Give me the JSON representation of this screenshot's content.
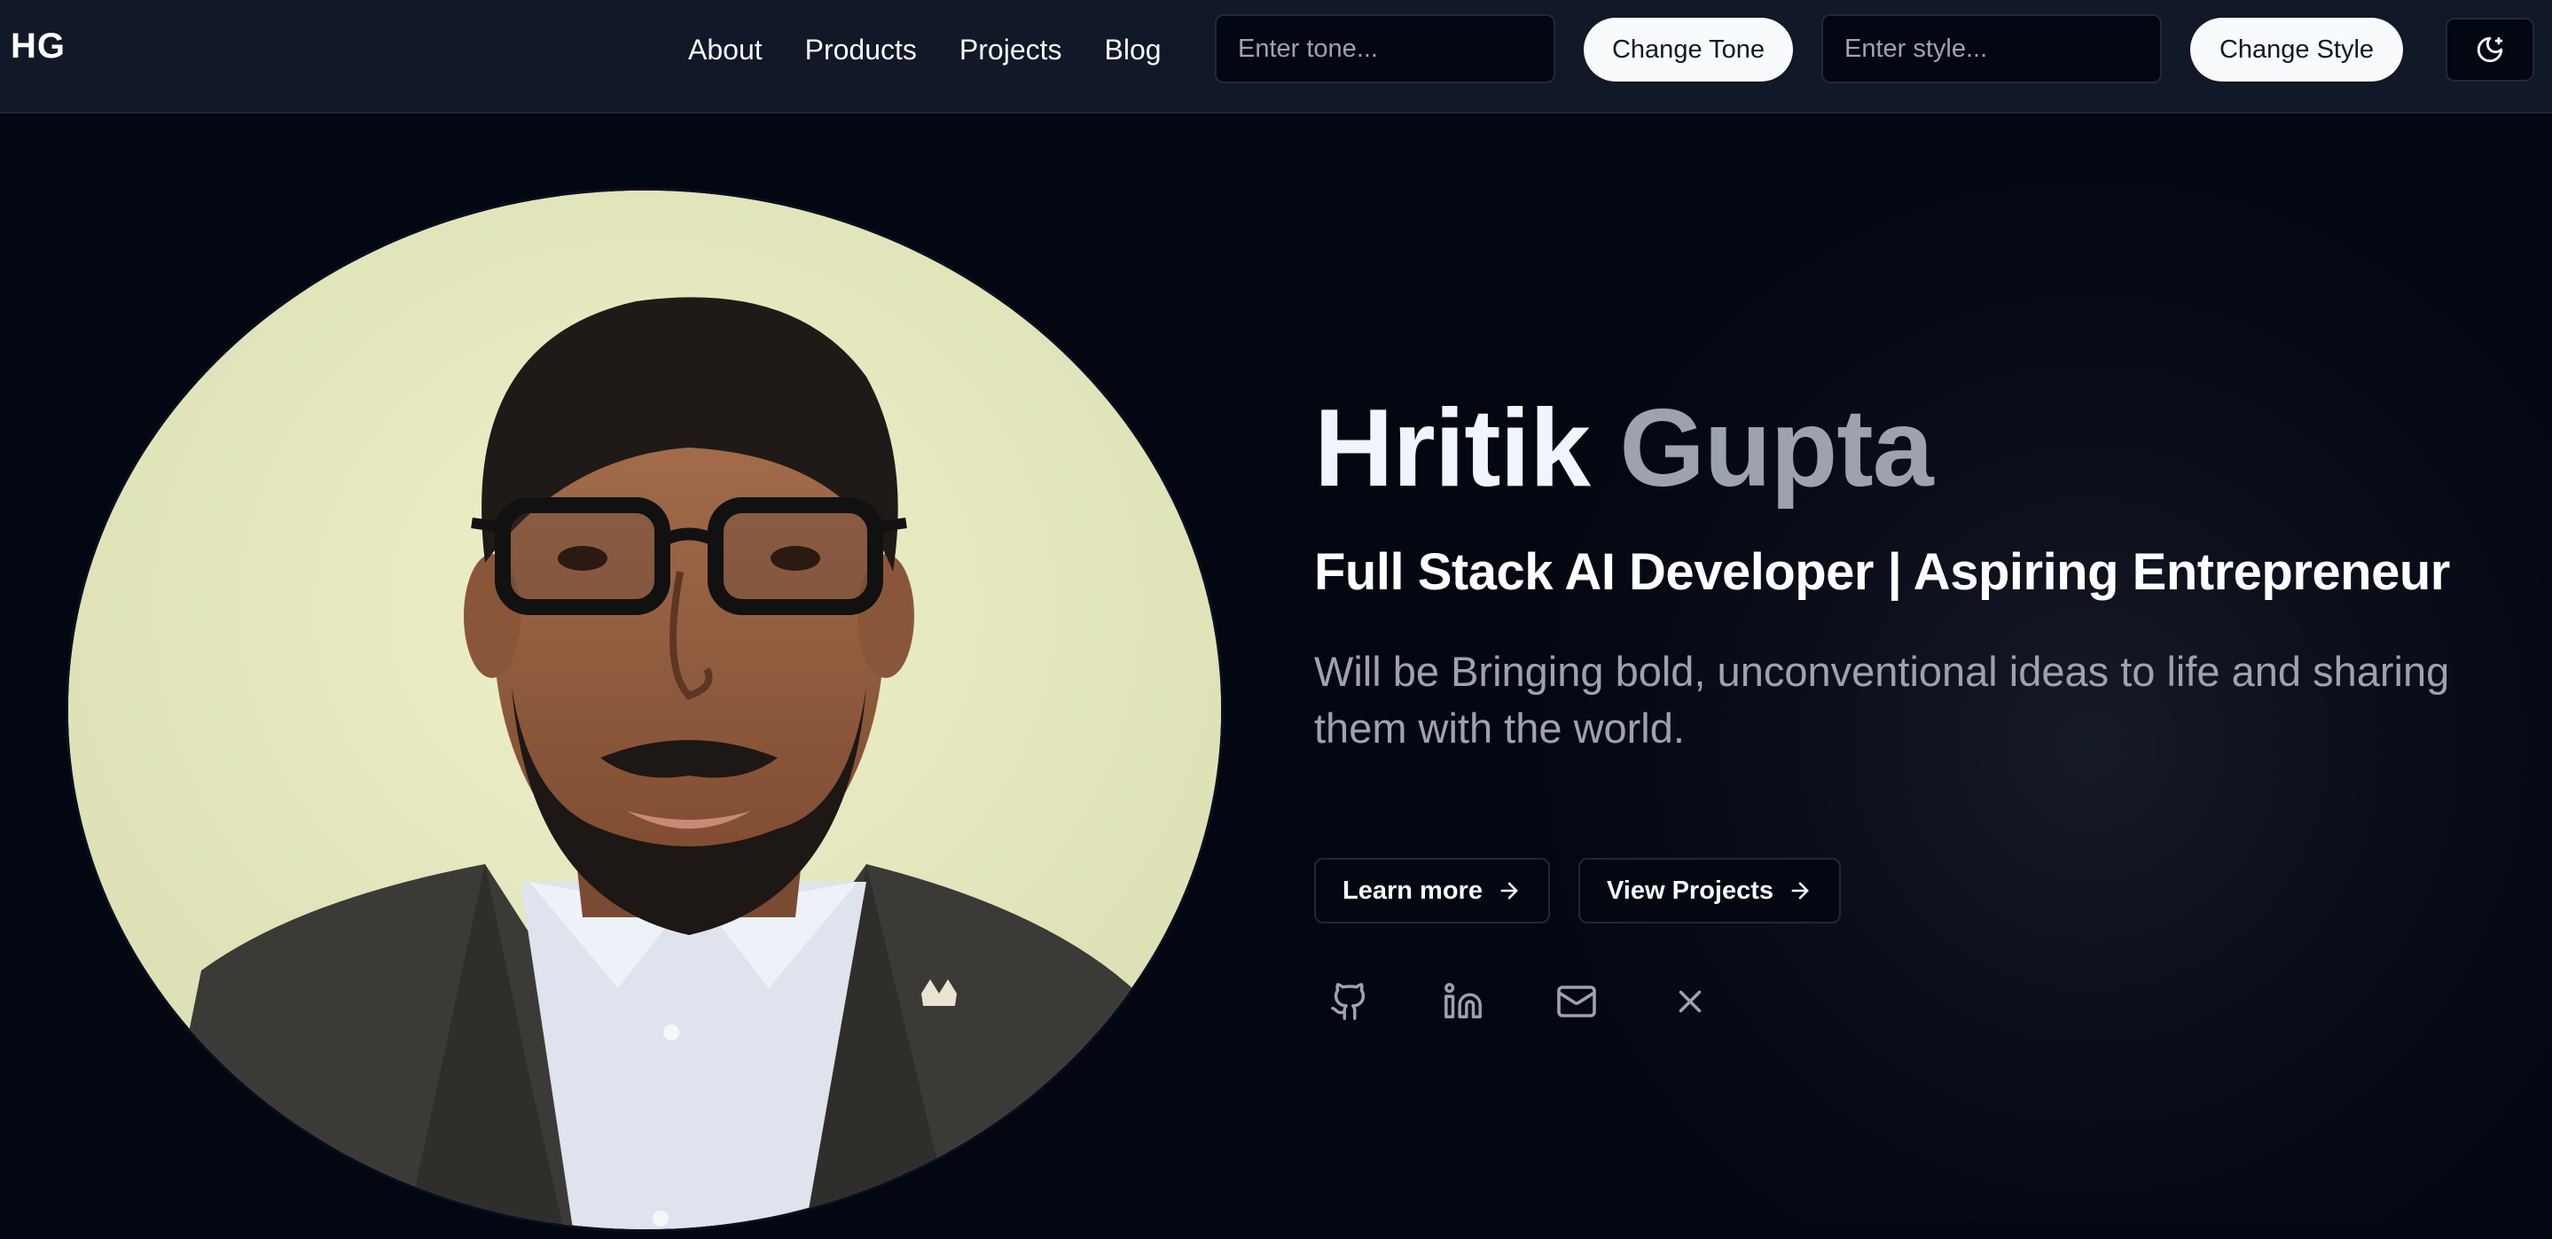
{
  "nav": {
    "logo": "HG",
    "links": [
      "About",
      "Products",
      "Projects",
      "Blog"
    ],
    "tone_placeholder": "Enter tone...",
    "tone_button": "Change Tone",
    "style_placeholder": "Enter style...",
    "style_button": "Change Style",
    "theme_icon": "moon-stars-icon"
  },
  "hero": {
    "name_first": "Hritik",
    "name_last": "Gupta",
    "subtitle": "Full Stack AI Developer | Aspiring Entrepreneur",
    "bio": "Will be Bringing bold, unconventional ideas to life and sharing them with the world.",
    "learn_more": "Learn more",
    "view_projects": "View Projects",
    "socials": [
      "github-icon",
      "linkedin-icon",
      "mail-icon",
      "x-icon"
    ]
  },
  "colors": {
    "background": "#030712",
    "nav_background": "#111827",
    "accent_light": "#f8fafc",
    "muted_text": "#9ca3af",
    "photo_background": "#e6e9bf"
  }
}
